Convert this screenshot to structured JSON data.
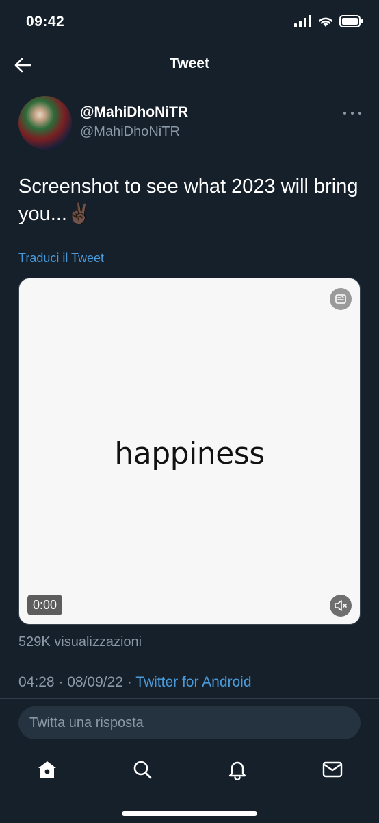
{
  "status_bar": {
    "time": "09:42"
  },
  "header": {
    "title": "Tweet"
  },
  "tweet": {
    "display_name": "@MahiDhoNiTR",
    "handle": "@MahiDhoNiTR",
    "text": "Screenshot to see what 2023 will bring you...✌🏿",
    "translate_label": "Traduci il Tweet",
    "media": {
      "word": "happiness",
      "video_time": "0:00"
    },
    "views": "529K visualizzazioni",
    "time": "04:28",
    "date": "08/09/22",
    "source": "Twitter for Android"
  },
  "reply": {
    "placeholder": "Twitta una risposta"
  },
  "tabs": [
    {
      "icon": "home-icon"
    },
    {
      "icon": "search-icon"
    },
    {
      "icon": "bell-icon"
    },
    {
      "icon": "mail-icon"
    }
  ],
  "colors": {
    "background": "#15202b",
    "accent": "#4a9ad9",
    "muted": "#8b98a5"
  }
}
